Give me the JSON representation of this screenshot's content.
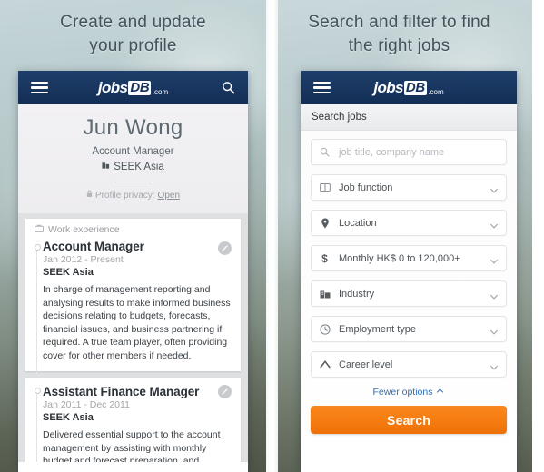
{
  "left": {
    "headline": "Create and update\nyour profile",
    "navbar": {
      "menu_icon": "hamburger-icon",
      "logo_jobs": "jobs",
      "logo_db": "DB",
      "logo_com": ".com",
      "search_icon": "search-icon"
    },
    "profile": {
      "name": "Jun Wong",
      "title": "Account Manager",
      "company": "SEEK Asia",
      "company_icon": "building-icon",
      "privacy_icon": "lock-icon",
      "privacy_label": "Profile privacy:",
      "privacy_value": "Open"
    },
    "work_experience": {
      "section_icon": "briefcase-icon",
      "section_label": "Work experience",
      "entries": [
        {
          "title": "Account Manager",
          "dates": "Jan 2012 - Present",
          "company": "SEEK Asia",
          "description": "In charge of management reporting and analysing results to make informed business decisions relating to budgets, forecasts, financial issues, and business partnering if required.  A true team player, often providing cover for other members if needed.",
          "edit_icon": "edit-pencil-icon"
        },
        {
          "title": "Assistant Finance Manager",
          "dates": "Jan 2011 - Dec 2011",
          "company": "SEEK Asia",
          "description": "Delivered essential support to the account management by assisting with monthly budget and forecast preparation, and",
          "edit_icon": "edit-pencil-icon"
        }
      ]
    }
  },
  "right": {
    "headline": "Search and filter to find\nthe right jobs",
    "navbar": {
      "menu_icon": "hamburger-icon",
      "logo_jobs": "jobs",
      "logo_db": "DB",
      "logo_com": ".com"
    },
    "search_header": "Search jobs",
    "keyword_field": {
      "icon": "search-icon",
      "placeholder": "job title, company name",
      "value": ""
    },
    "filters": [
      {
        "icon": "job-function-icon",
        "label": "Job function"
      },
      {
        "icon": "location-pin-icon",
        "label": "Location"
      },
      {
        "icon": "dollar-icon",
        "label": "Monthly HK$ 0 to 120,000+"
      },
      {
        "icon": "industry-icon",
        "label": "Industry"
      },
      {
        "icon": "clock-icon",
        "label": "Employment type"
      },
      {
        "icon": "career-level-icon",
        "label": "Career level"
      }
    ],
    "fewer_options": "Fewer options",
    "fewer_options_icon": "chevron-up-icon",
    "search_button": "Search"
  },
  "colors": {
    "navy": "#17335b",
    "orange": "#f57d11",
    "link_blue": "#2f6fb5",
    "headline_text": "#44525c"
  }
}
